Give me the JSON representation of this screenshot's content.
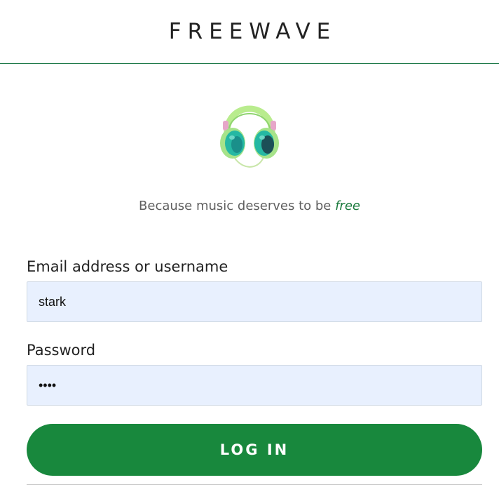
{
  "header": {
    "brand": "FREEWAVE"
  },
  "logo": {
    "icon": "headphones-icon",
    "colors": {
      "band": "#a6e38a",
      "cup": "#25b8a3",
      "accent": "#e7a6c9"
    }
  },
  "tagline": {
    "prefix": "Because music deserves to be ",
    "emphasis": "free"
  },
  "form": {
    "email_label": "Email address or username",
    "email_value": "stark",
    "password_label": "Password",
    "password_value": "1234",
    "submit_label": "LOG IN"
  },
  "theme": {
    "accent": "#18883d",
    "input_bg": "#e8f0fe"
  }
}
